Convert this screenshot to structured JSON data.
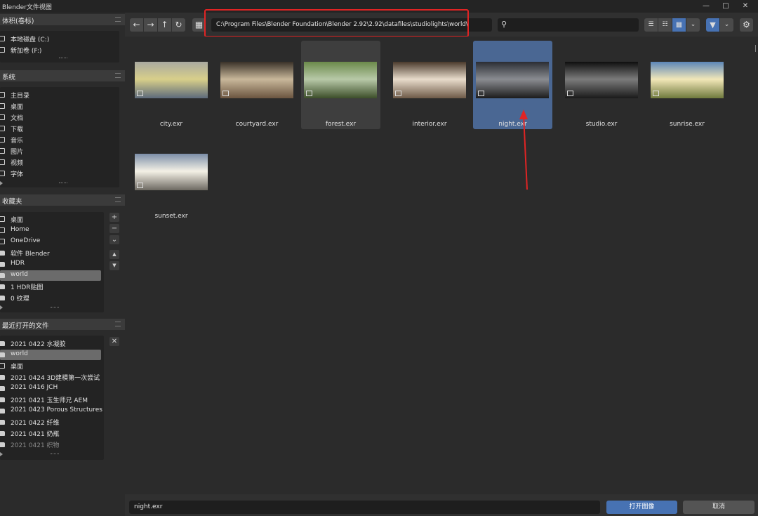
{
  "window": {
    "title": "Blender文件视图"
  },
  "sidebar": {
    "volumes": {
      "title": "体积(卷标)",
      "items": [
        {
          "label": "本地磁盘 (C:)"
        },
        {
          "label": "新加卷 (F:)"
        }
      ]
    },
    "system": {
      "title": "系统",
      "items": [
        {
          "label": "主目录"
        },
        {
          "label": "桌面"
        },
        {
          "label": "文档"
        },
        {
          "label": "下载"
        },
        {
          "label": "音乐"
        },
        {
          "label": "图片"
        },
        {
          "label": "视频"
        },
        {
          "label": "字体"
        }
      ]
    },
    "bookmarks": {
      "title": "收藏夹",
      "items": [
        {
          "label": "桌面"
        },
        {
          "label": "Home"
        },
        {
          "label": "OneDrive"
        },
        {
          "label": "软件 Blender"
        },
        {
          "label": "HDR"
        },
        {
          "label": "world",
          "selected": true
        },
        {
          "label": "1 HDR贴图"
        },
        {
          "label": "0 纹理"
        }
      ]
    },
    "recent": {
      "title": "最近打开的文件",
      "items": [
        {
          "label": "2021 0422 水凝胶"
        },
        {
          "label": "world",
          "selected": true
        },
        {
          "label": "桌面"
        },
        {
          "label": "2021 0424 3D建模第一次尝试"
        },
        {
          "label": "2021 0416 JCH"
        },
        {
          "label": "2021 0421 玉生师兄 AEM"
        },
        {
          "label": "2021 0423 Porous Structures"
        },
        {
          "label": "2021 0422 纤维"
        },
        {
          "label": "2021 0421 奶瓶"
        },
        {
          "label": "2021 0421 织物"
        }
      ]
    }
  },
  "toolbar": {
    "path": "C:\\Program Files\\Blender Foundation\\Blender 2.92\\2.92\\datafiles\\studiolights\\world\\",
    "search_placeholder": ""
  },
  "files": [
    {
      "name": "city.exr",
      "colors": [
        "#a9a9a0",
        "#d8cf8a",
        "#5d6a7b"
      ]
    },
    {
      "name": "courtyard.exr",
      "colors": [
        "#3a3128",
        "#c8b79a",
        "#6b5540"
      ]
    },
    {
      "name": "forest.exr",
      "colors": [
        "#6b8a4a",
        "#b8c9a8",
        "#3d4f2a"
      ]
    },
    {
      "name": "interior.exr",
      "colors": [
        "#4a3a2c",
        "#e8dccb",
        "#6e5a48"
      ]
    },
    {
      "name": "night.exr",
      "colors": [
        "#2a2d33",
        "#8a8c91",
        "#1c1c1c"
      ]
    },
    {
      "name": "studio.exr",
      "colors": [
        "#0e0e0e",
        "#7b7b7b",
        "#1a1a1a"
      ]
    },
    {
      "name": "sunrise.exr",
      "colors": [
        "#5c86b8",
        "#f2e7b8",
        "#6f7a3d"
      ]
    },
    {
      "name": "sunset.exr",
      "colors": [
        "#7c8ea8",
        "#f4f1e6",
        "#6e6a62"
      ]
    }
  ],
  "selected_file": "night.exr",
  "bottom": {
    "filename": "night.exr",
    "open_label": "打开图像",
    "cancel_label": "取消"
  },
  "colors": {
    "accent": "#4772b3",
    "selection": "#4a6793",
    "annotation": "#e02424"
  }
}
